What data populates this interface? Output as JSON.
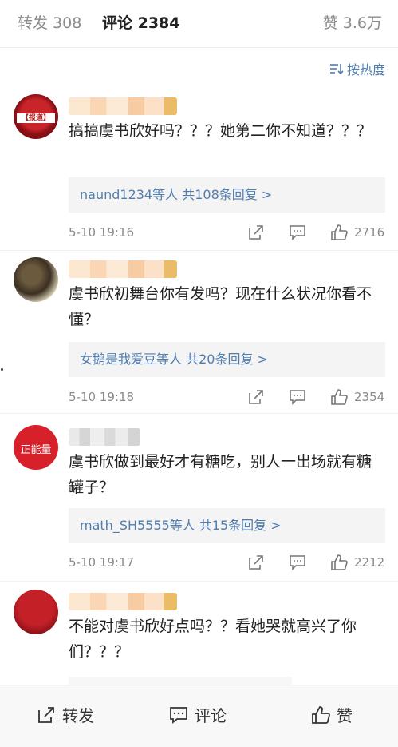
{
  "tabs": {
    "repost": "转发 308",
    "comment": "评论 2384",
    "like": "赞 3.6万"
  },
  "sort": {
    "label": "按热度"
  },
  "comments": [
    {
      "avatar_text": "【报道】",
      "text": "搞搞虞书欣好吗？？？她第二你不知道？？？",
      "reply_user": "naund1234等人",
      "reply_count": "共108条回复 >",
      "time": "5-10 19:16",
      "likes": "2716"
    },
    {
      "text": "虞书欣初舞台你有发吗？现在什么状况你看不懂？",
      "reply_user": "女鹅是我爱豆等人",
      "reply_count": "共20条回复 >",
      "time": "5-10 19:18",
      "likes": "2354"
    },
    {
      "avatar_text": "正能量",
      "text": "虞书欣做到最好才有糖吃，别人一出场就有糖罐子？",
      "reply_user": "math_SH5555等人",
      "reply_count": "共15条回复 >",
      "time": "5-10 19:17",
      "likes": "2212"
    },
    {
      "text": "不能对虞书欣好点吗？？看她哭就高兴了你们？？？"
    }
  ],
  "bottom_bar": {
    "repost": "转发",
    "comment": "评论",
    "like": "赞"
  },
  "colors": {
    "link": "#507daf",
    "accent": "#ff8200"
  }
}
